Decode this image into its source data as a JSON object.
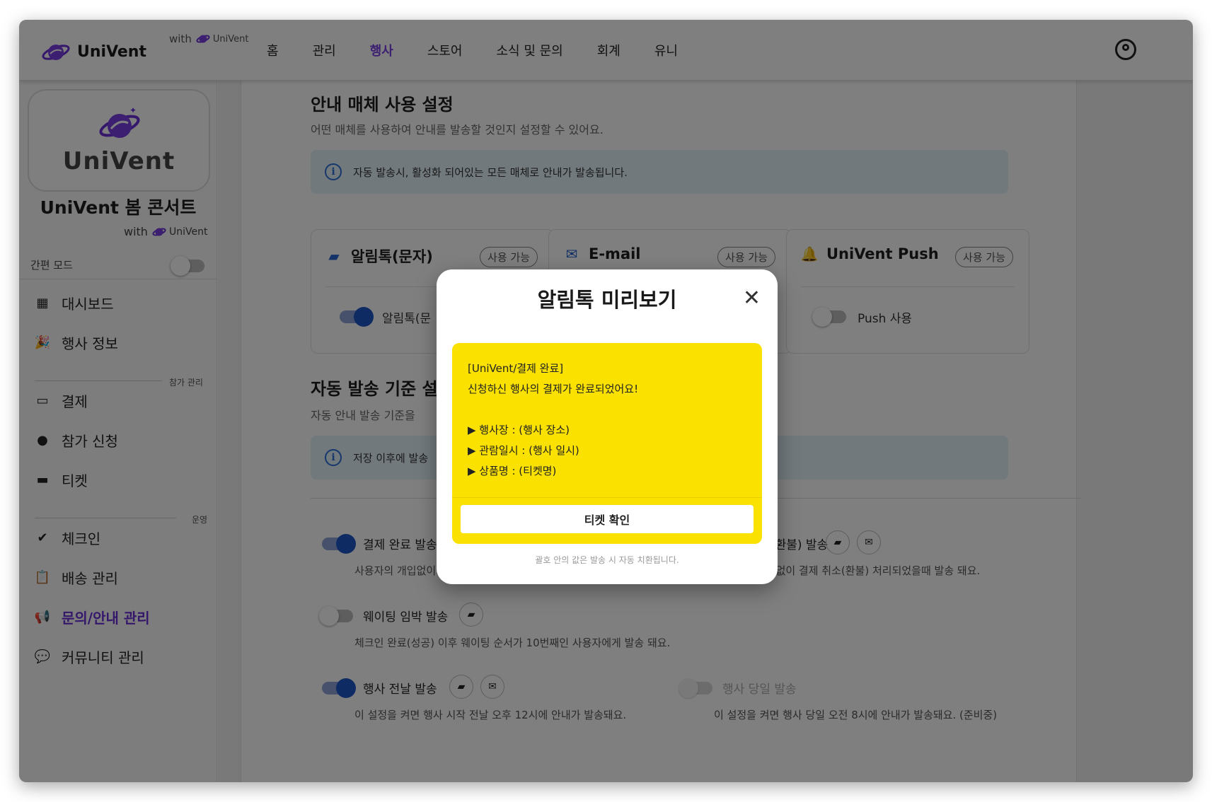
{
  "nav": {
    "brand": "UniVent",
    "with": "with",
    "with_brand": "UniVent",
    "menu": [
      "홈",
      "관리",
      "행사",
      "스토어",
      "소식 및 문의",
      "회계",
      "유니"
    ]
  },
  "sidebar": {
    "card_brand": "UniVent",
    "event_title": "UniVent 봄 콘서트",
    "with": "with",
    "with_brand": "UniVent",
    "simple_mode": "간편 모드",
    "items": [
      {
        "label": "대시보드",
        "icon": "dashboard-icon"
      },
      {
        "label": "행사 정보",
        "icon": "party-icon"
      },
      {
        "label": "결제",
        "icon": "credit-card-icon"
      },
      {
        "label": "참가 신청",
        "icon": "person-icon"
      },
      {
        "label": "티켓",
        "icon": "ticket-icon"
      },
      {
        "label": "체크인",
        "icon": "check-circle-icon"
      },
      {
        "label": "배송 관리",
        "icon": "clipboard-icon"
      },
      {
        "label": "문의/안내 관리",
        "icon": "megaphone-icon"
      },
      {
        "label": "커뮤니티 관리",
        "icon": "forum-icon"
      }
    ],
    "section_participation": "참가 관리",
    "section_operation": "운영",
    "active_color": "#6a2fd6"
  },
  "main": {
    "media_title": "안내 매체 사용 설정",
    "media_sub": "어떤 매체를 사용하여 안내를 발송할 것인지 설정할 수 있어요.",
    "media_alert": "자동 발송시, 활성화 되어있는 모든 매체로 안내가 발송됩니다.",
    "media": [
      {
        "title": "알림톡(문자)",
        "badge": "사용 가능",
        "toggle_label": "알림톡(문",
        "on": true
      },
      {
        "title": "E-mail",
        "badge": "사용 가능",
        "toggle_label": "",
        "on": true
      },
      {
        "title": "UniVent Push",
        "badge": "사용 가능",
        "toggle_label": "Push 사용",
        "on": false
      }
    ],
    "auto_title": "자동 발송 기준 설",
    "auto_sub": "자동 안내 발송 기준을",
    "auto_alert": "저장 이후에 발송",
    "options": [
      {
        "title": "결제 완료 발송",
        "desc": "사용자의 개입없이 결제 완료 처리되었을때 발송 돼요.",
        "on": true
      },
      {
        "title": "결제 취소(환불) 발송",
        "desc": "사용자의 개입없이 결제 취소(환불) 처리되었을때 발송 돼요.",
        "on": true
      },
      {
        "title": "웨이팅 임박 발송",
        "desc": "체크인 완료(성공) 이후 웨이팅 순서가 10번째인 사용자에게 발송 돼요.",
        "on": false
      },
      {
        "title": "행사 전날 발송",
        "desc": "이 설정을 켜면 행사 시작 전날 오후 12시에 안내가 발송돼요.",
        "on": true
      },
      {
        "title": "행사 당일 발송",
        "desc": "이 설정을 켜면 행사 당일 오전 8시에 안내가 발송돼요. (준비중)",
        "on": false
      }
    ]
  },
  "modal": {
    "title": "알림톡 미리보기",
    "message": "[UniVent/결제 완료]\n신청하신 행사의 결제가 완료되었어요!\n\n▶ 행사장 : (행사 장소)\n▶ 관람일시 : (행사 일시)\n▶ 상품명 : (티켓명)",
    "button": "티켓 확인",
    "note": "괄호 안의 값은 발송 시 자동 치환됩니다.",
    "kakao_color": "#fae100"
  },
  "colors": {
    "accent": "#7b3fe4",
    "toggle_on": "#1e56c7",
    "info_bg": "#e3f3fb"
  }
}
